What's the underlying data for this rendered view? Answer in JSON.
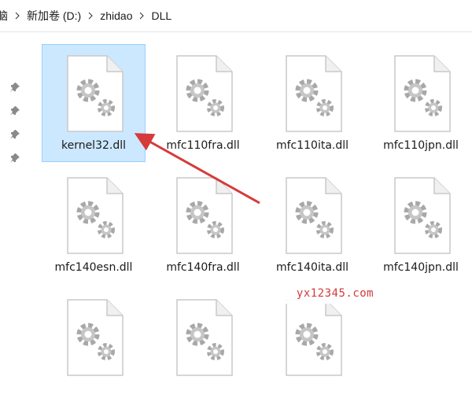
{
  "breadcrumb": {
    "items": [
      "脑",
      "新加卷 (D:)",
      "zhidao",
      "DLL"
    ]
  },
  "files": [
    {
      "name": "kernel32.dll",
      "selected": true
    },
    {
      "name": "mfc110fra.dll",
      "selected": false
    },
    {
      "name": "mfc110ita.dll",
      "selected": false
    },
    {
      "name": "mfc110jpn.dll",
      "selected": false
    },
    {
      "name": "mfc140esn.dll",
      "selected": false
    },
    {
      "name": "mfc140fra.dll",
      "selected": false
    },
    {
      "name": "mfc140ita.dll",
      "selected": false
    },
    {
      "name": "mfc140jpn.dll",
      "selected": false
    }
  ],
  "icons": {
    "file": "dll-file-icon",
    "pin": "pin-icon",
    "separator": "chevron-right-icon"
  },
  "colors": {
    "selection_bg": "#cce8ff",
    "selection_border": "#99d1ff",
    "annotation_arrow": "#d63b3b",
    "watermark_text": "#d33a3a"
  },
  "watermark": "yx12345.com"
}
